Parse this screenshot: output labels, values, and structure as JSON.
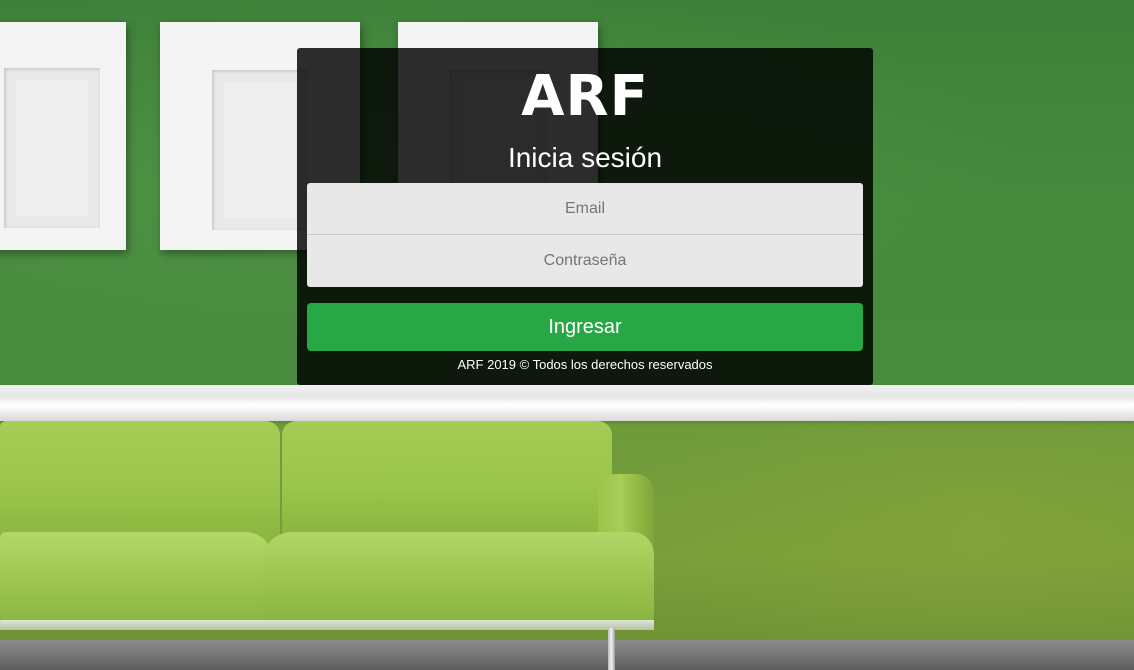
{
  "login": {
    "logo_text": "ARF",
    "title": "Inicia sesión",
    "email_placeholder": "Email",
    "password_placeholder": "Contraseña",
    "submit_label": "Ingresar",
    "footer": "ARF 2019 © Todos los derechos reservados"
  },
  "colors": {
    "accent": "#28a745",
    "card_background": "rgba(0,0,0,0.82)",
    "wall": "#4a8c3f"
  }
}
